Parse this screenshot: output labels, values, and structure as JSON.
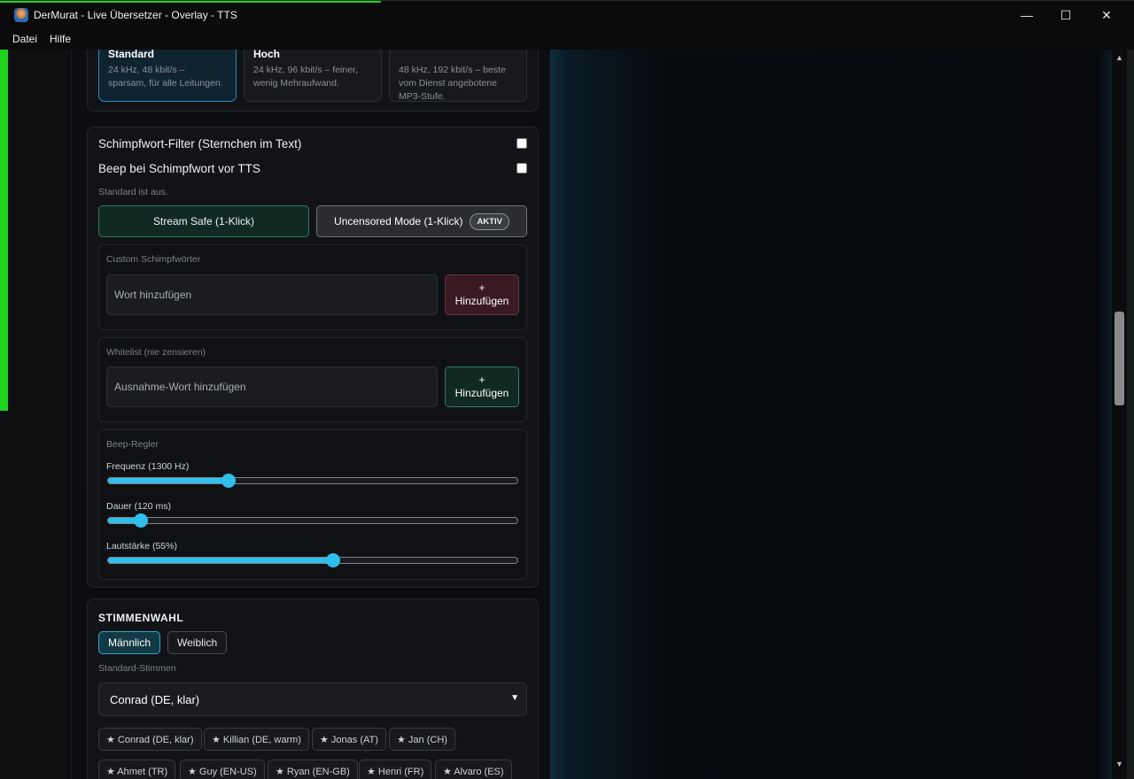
{
  "window": {
    "title": "DerMurat - Live Übersetzer - Overlay - TTS",
    "minimize": "—",
    "maximize": "☐",
    "close": "✕"
  },
  "menu": [
    "Datei",
    "Hilfe"
  ],
  "quality": {
    "options": [
      {
        "name": "Standard",
        "desc1": "24 kHz, 48 kbit/s –",
        "desc2": "sparsam, für alle Leitungen.",
        "desc3": "",
        "active": true
      },
      {
        "name": "Hoch",
        "desc1": "24 kHz, 96 kbit/s – feiner,",
        "desc2": "wenig Mehraufwand.",
        "desc3": "",
        "active": false
      },
      {
        "name": "",
        "desc1": "48 kHz, 192 kbit/s – beste",
        "desc2": "vom Dienst angebotene",
        "desc3": "MP3-Stufe.",
        "active": false
      }
    ]
  },
  "filter": {
    "profanity_label": "Schimpfwort-Filter (Sternchen im Text)",
    "beep_label": "Beep bei Schimpfwort vor TTS",
    "hint": "Standard ist aus.",
    "stream_safe": "Stream Safe (1-Klick)",
    "uncensored": "Uncensored Mode (1-Klick)",
    "active_badge": "AKTIV",
    "custom": {
      "label": "Custom Schimpfwörter",
      "placeholder": "Wort hinzufügen",
      "add_plus": "+",
      "add_text": "Hinzufügen"
    },
    "whitelist": {
      "label": "Whitelist (nie zensieren)",
      "placeholder": "Ausnahme-Wort hinzufügen",
      "add_plus": "+",
      "add_text": "Hinzufügen"
    },
    "beep": {
      "label": "Beep-Regler",
      "frequency": {
        "label": "Frequenz (1300 Hz)",
        "value": 0.295
      },
      "duration": {
        "label": "Dauer (120 ms)",
        "value": 0.08
      },
      "volume": {
        "label": "Lautstärke (55%)",
        "value": 0.55
      }
    }
  },
  "voices": {
    "title": "STIMMENWAHL",
    "male": "Männlich",
    "female": "Weiblich",
    "standard_label": "Standard-Stimmen",
    "selected": "Conrad (DE, klar)",
    "chips_row1": [
      "★ Conrad (DE, klar)",
      "★ Killian (DE, warm)",
      "★ Jonas (AT)",
      "★ Jan (CH)"
    ],
    "chips_row2": [
      "★ Ahmet (TR)",
      "★ Guy (EN-US)",
      "★ Ryan (EN-GB)",
      "★ Henri (FR)",
      "★ Alvaro (ES)"
    ]
  },
  "colors": {
    "accent": "#2fbfec",
    "safe_green": "#2f7d62",
    "add_red": "#6b3440"
  }
}
